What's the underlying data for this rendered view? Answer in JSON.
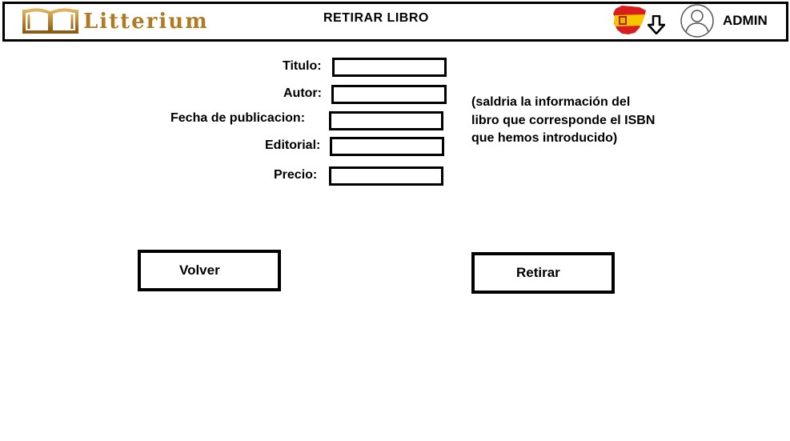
{
  "header": {
    "brand": "Litterium",
    "title": "RETIRAR  LIBRO",
    "language_icon": "spain-flag-icon",
    "dropdown_icon": "arrow-down-icon",
    "user_icon": "user-avatar-icon",
    "user_label": "ADMIN",
    "brand_color": "#b07a22"
  },
  "form": {
    "titulo_label": "Titulo:",
    "autor_label": "Autor:",
    "fecha_label": "Fecha de publicacion:",
    "editorial_label": "Editorial:",
    "precio_label": "Precio:"
  },
  "info_note": {
    "line1": "(saldria la información del",
    "line2": "libro que corresponde el ISBN",
    "line3": "que hemos introducido)"
  },
  "actions": {
    "volver_label": "Volver",
    "retirar_label": "Retirar"
  }
}
